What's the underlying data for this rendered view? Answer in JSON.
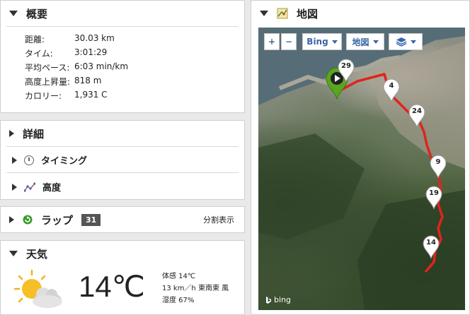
{
  "summary": {
    "title": "概要",
    "rows": [
      {
        "label": "距離:",
        "value": "30.03 km"
      },
      {
        "label": "タイム:",
        "value": "3:01:29"
      },
      {
        "label": "平均ペース:",
        "value": "6:03 min/km"
      },
      {
        "label": "高度上昇量:",
        "value": "818 m"
      },
      {
        "label": "カロリー:",
        "value": "1,931 C"
      }
    ]
  },
  "details": {
    "title": "詳細",
    "timing_label": "タイミング",
    "elevation_label": "高度"
  },
  "laps": {
    "title": "ラップ",
    "count": "31",
    "split_view_label": "分割表示"
  },
  "weather": {
    "title": "天気",
    "temperature": "14℃",
    "feels_like": "体感 14℃",
    "wind": "13 km／h 東南東 風",
    "humidity": "湿度 67%"
  },
  "map": {
    "title": "地図",
    "zoom_in": "+",
    "zoom_out": "−",
    "provider_button": "Bing",
    "type_button": "地図",
    "attribution": "bing",
    "markers": [
      "29",
      "4",
      "24",
      "9",
      "19",
      "14"
    ],
    "route_color": "#e0241c",
    "start_marker_color": "#5aa51e"
  }
}
